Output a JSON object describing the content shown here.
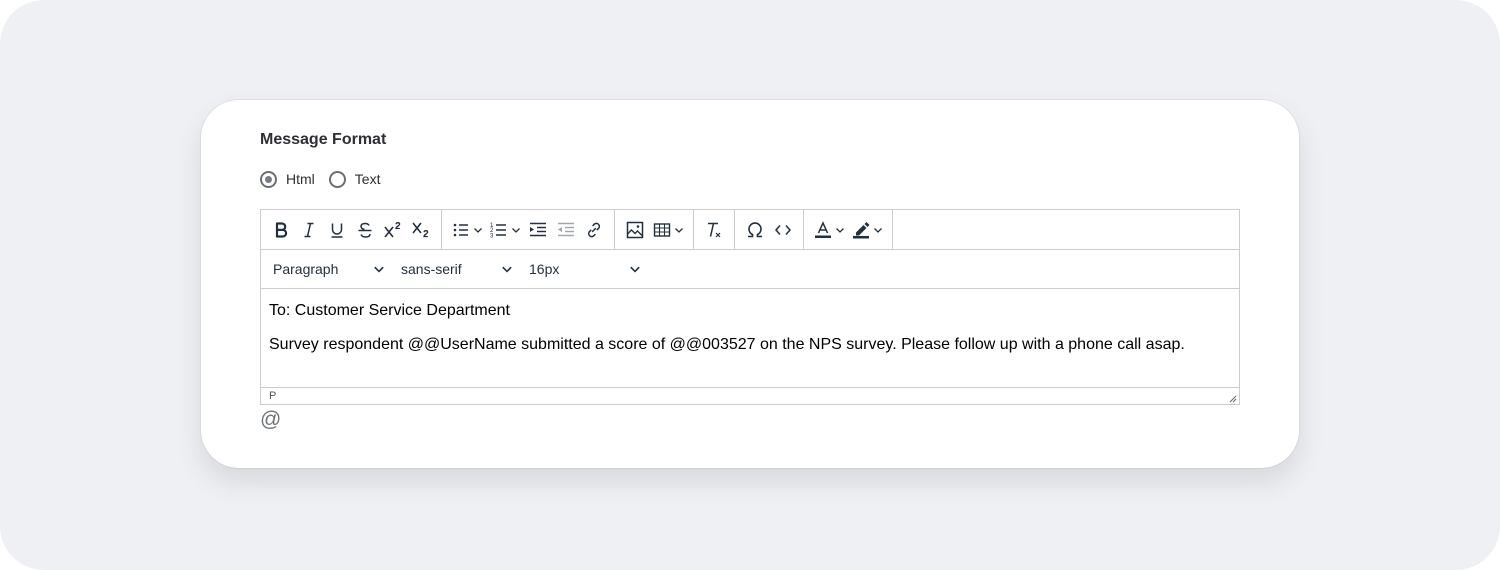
{
  "form": {
    "title": "Message Format",
    "format_options": [
      {
        "label": "Html",
        "selected": true
      },
      {
        "label": "Text",
        "selected": false
      }
    ]
  },
  "editor": {
    "toolbar_icons": [
      "bold-icon",
      "italic-icon",
      "underline-icon",
      "strikethrough-icon",
      "superscript-icon",
      "subscript-icon",
      "bullet-list-icon",
      "numbered-list-icon",
      "indent-icon",
      "outdent-icon",
      "link-icon",
      "image-icon",
      "table-icon",
      "clear-formatting-icon",
      "special-character-icon",
      "source-code-icon",
      "text-color-icon",
      "highlight-color-icon"
    ],
    "block_format": "Paragraph",
    "font_family": "sans-serif",
    "font_size": "16px",
    "content": [
      "To: Customer Service Department",
      "Survey respondent @@UserName submitted a score of @@003527 on the NPS survey. Please follow up with a phone call asap."
    ],
    "status_path": "P"
  },
  "insert_variable_symbol": "@",
  "colors": {
    "page_background": "#eff0f4",
    "card_background": "#ffffff",
    "border": "#cccccc",
    "icon": "#222f3e"
  }
}
